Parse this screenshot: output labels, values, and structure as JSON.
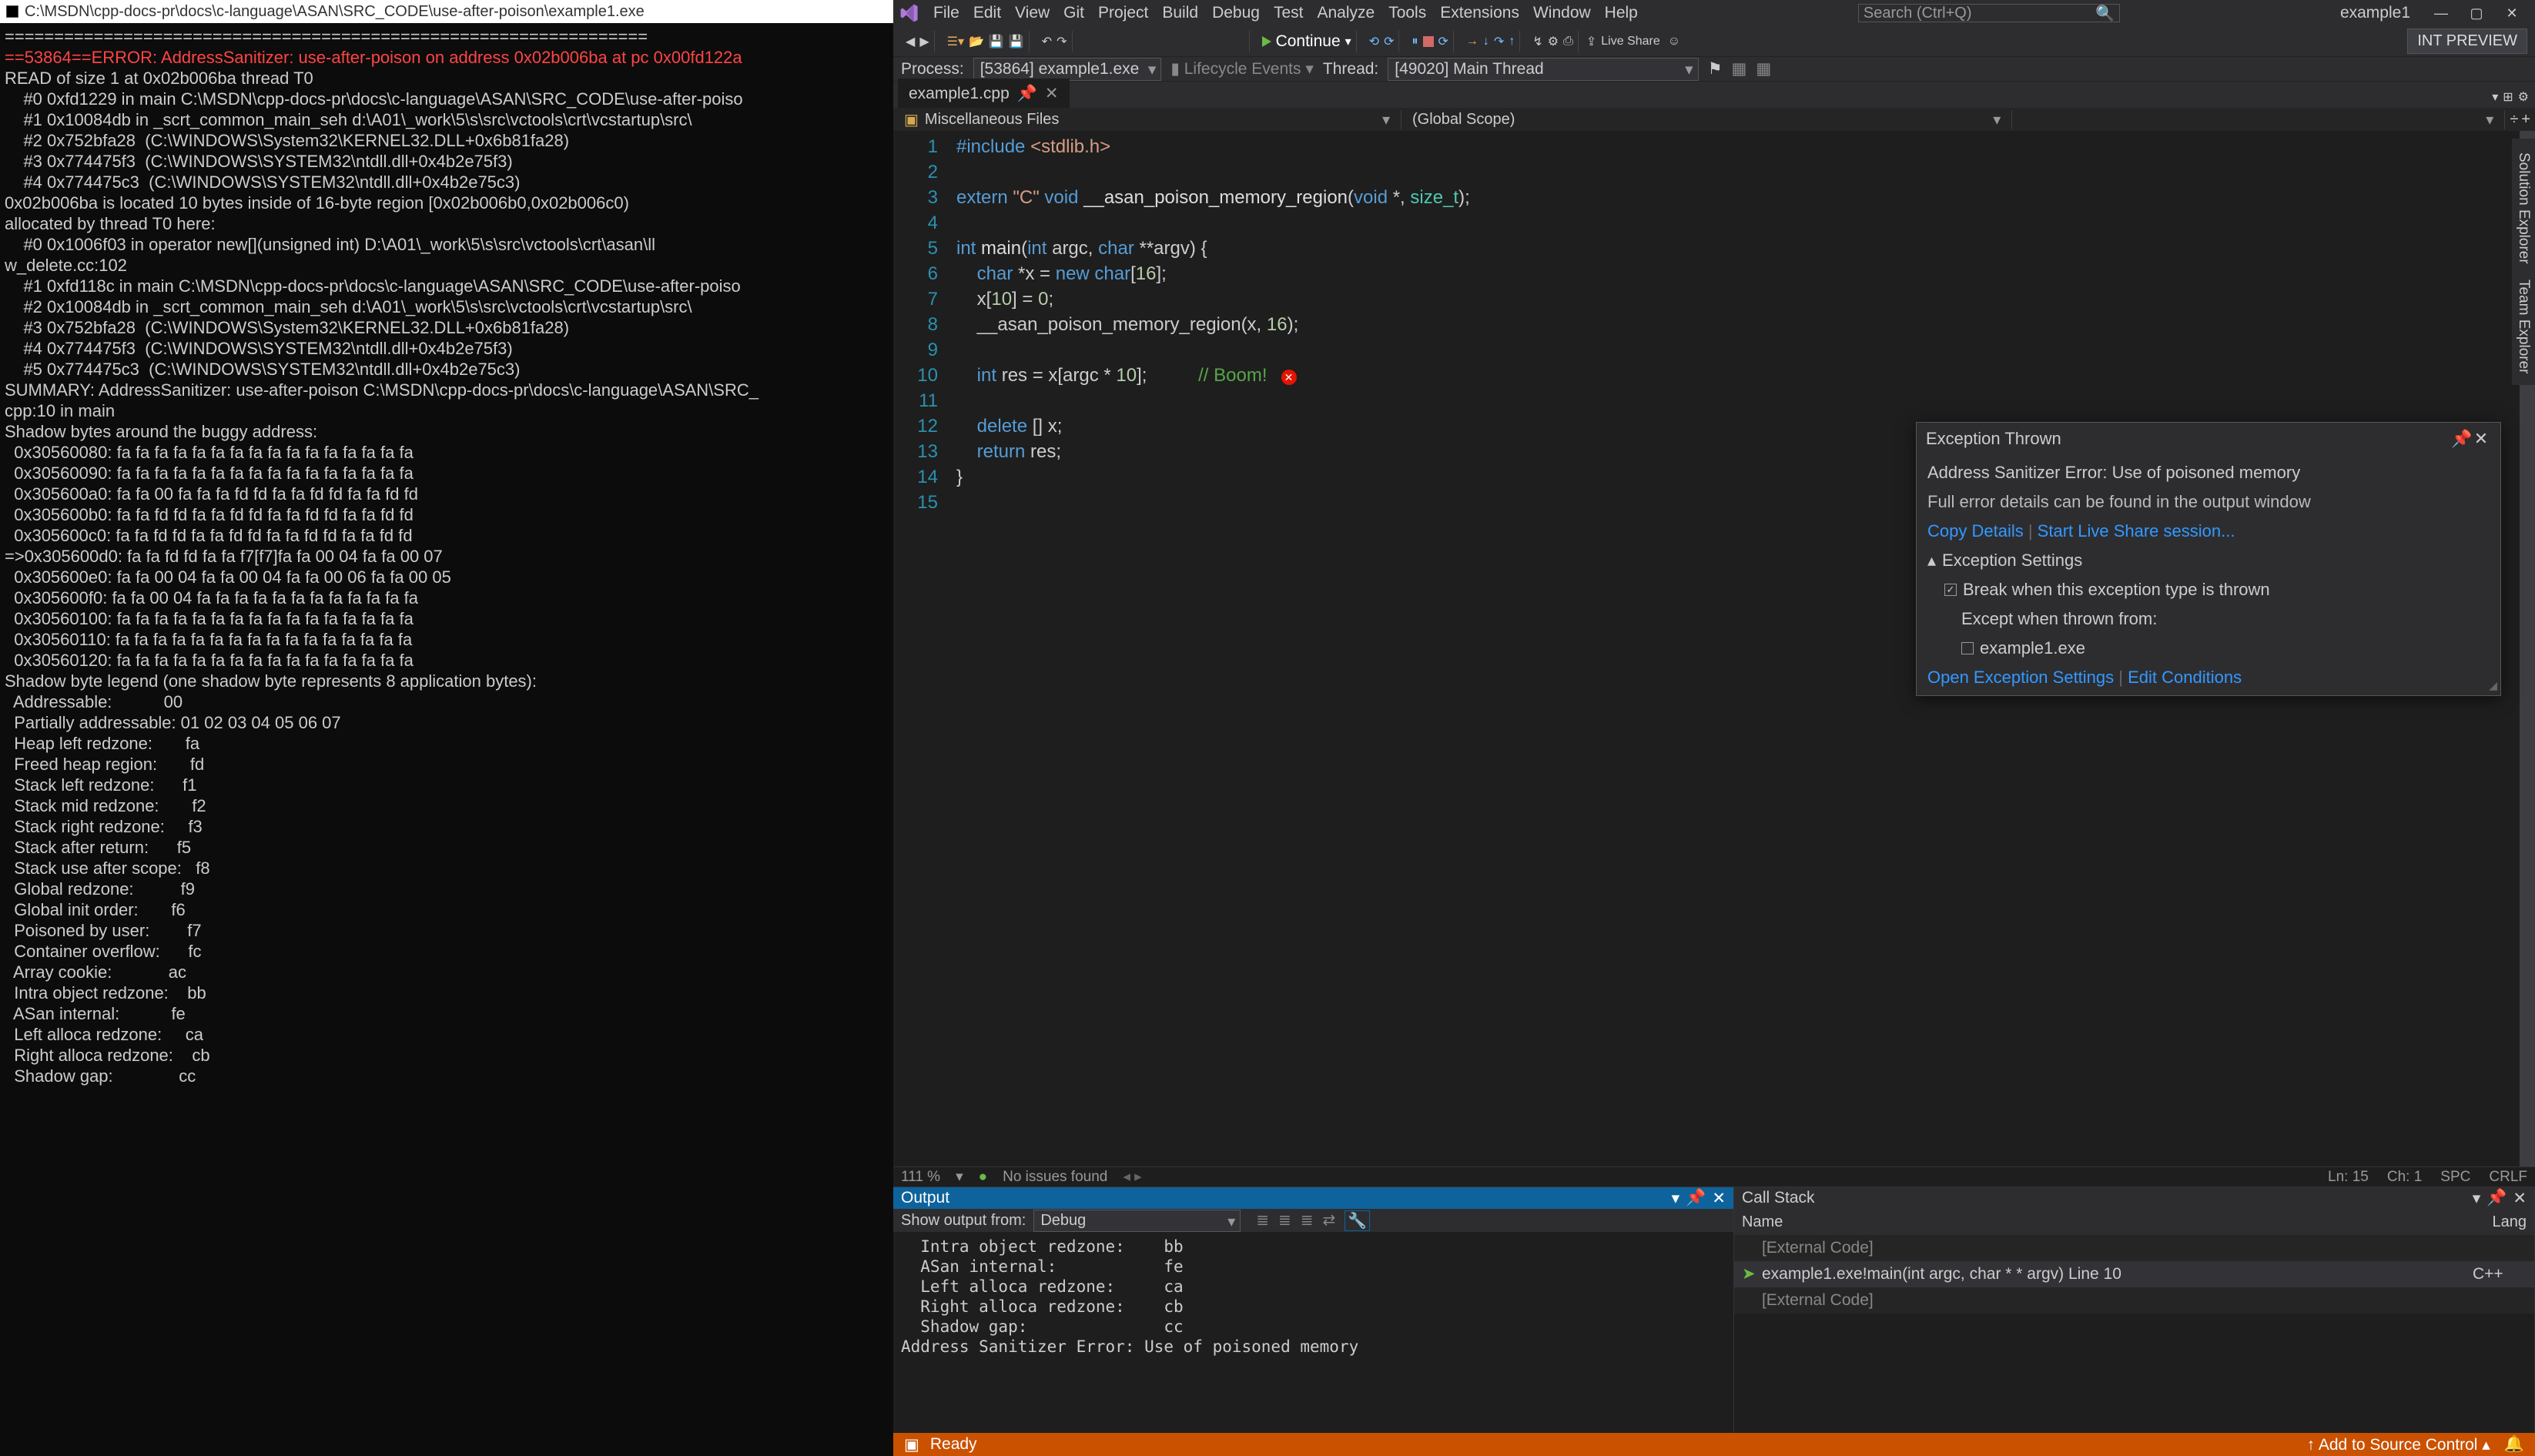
{
  "console": {
    "title": "C:\\MSDN\\cpp-docs-pr\\docs\\c-language\\ASAN\\SRC_CODE\\use-after-poison\\example1.exe",
    "lines": [
      "=================================================================",
      "==53864==ERROR: AddressSanitizer: use-after-poison on address 0x02b006ba at pc 0x00fd122a",
      "READ of size 1 at 0x02b006ba thread T0",
      "    #0 0xfd1229 in main C:\\MSDN\\cpp-docs-pr\\docs\\c-language\\ASAN\\SRC_CODE\\use-after-poiso",
      "    #1 0x10084db in _scrt_common_main_seh d:\\A01\\_work\\5\\s\\src\\vctools\\crt\\vcstartup\\src\\",
      "    #2 0x752bfa28  (C:\\WINDOWS\\System32\\KERNEL32.DLL+0x6b81fa28)",
      "    #3 0x774475f3  (C:\\WINDOWS\\SYSTEM32\\ntdll.dll+0x4b2e75f3)",
      "    #4 0x774475c3  (C:\\WINDOWS\\SYSTEM32\\ntdll.dll+0x4b2e75c3)",
      "",
      "0x02b006ba is located 10 bytes inside of 16-byte region [0x02b006b0,0x02b006c0)",
      "allocated by thread T0 here:",
      "    #0 0x1006f03 in operator new[](unsigned int) D:\\A01\\_work\\5\\s\\src\\vctools\\crt\\asan\\ll",
      "w_delete.cc:102",
      "    #1 0xfd118c in main C:\\MSDN\\cpp-docs-pr\\docs\\c-language\\ASAN\\SRC_CODE\\use-after-poiso",
      "    #2 0x10084db in _scrt_common_main_seh d:\\A01\\_work\\5\\s\\src\\vctools\\crt\\vcstartup\\src\\",
      "    #3 0x752bfa28  (C:\\WINDOWS\\System32\\KERNEL32.DLL+0x6b81fa28)",
      "    #4 0x774475f3  (C:\\WINDOWS\\SYSTEM32\\ntdll.dll+0x4b2e75f3)",
      "    #5 0x774475c3  (C:\\WINDOWS\\SYSTEM32\\ntdll.dll+0x4b2e75c3)",
      "",
      "SUMMARY: AddressSanitizer: use-after-poison C:\\MSDN\\cpp-docs-pr\\docs\\c-language\\ASAN\\SRC_",
      "cpp:10 in main",
      "Shadow bytes around the buggy address:",
      "  0x30560080: fa fa fa fa fa fa fa fa fa fa fa fa fa fa fa fa",
      "  0x30560090: fa fa fa fa fa fa fa fa fa fa fa fa fa fa fa fa",
      "  0x305600a0: fa fa 00 fa fa fa fd fd fa fa fd fd fa fa fd fd",
      "  0x305600b0: fa fa fd fd fa fa fd fd fa fa fd fd fa fa fd fd",
      "  0x305600c0: fa fa fd fd fa fa fd fd fa fa fd fd fa fa fd fd",
      "=>0x305600d0: fa fa fd fd fa fa f7[f7]fa fa 00 04 fa fa 00 07",
      "  0x305600e0: fa fa 00 04 fa fa 00 04 fa fa 00 06 fa fa 00 05",
      "  0x305600f0: fa fa 00 04 fa fa fa fa fa fa fa fa fa fa fa fa",
      "  0x30560100: fa fa fa fa fa fa fa fa fa fa fa fa fa fa fa fa",
      "  0x30560110: fa fa fa fa fa fa fa fa fa fa fa fa fa fa fa fa",
      "  0x30560120: fa fa fa fa fa fa fa fa fa fa fa fa fa fa fa fa",
      "Shadow byte legend (one shadow byte represents 8 application bytes):",
      "  Addressable:           00",
      "  Partially addressable: 01 02 03 04 05 06 07",
      "  Heap left redzone:       fa",
      "  Freed heap region:       fd",
      "  Stack left redzone:      f1",
      "  Stack mid redzone:       f2",
      "  Stack right redzone:     f3",
      "  Stack after return:      f5",
      "  Stack use after scope:   f8",
      "  Global redzone:          f9",
      "  Global init order:       f6",
      "  Poisoned by user:        f7",
      "  Container overflow:      fc",
      "  Array cookie:            ac",
      "  Intra object redzone:    bb",
      "  ASan internal:           fe",
      "  Left alloca redzone:     ca",
      "  Right alloca redzone:    cb",
      "  Shadow gap:              cc"
    ]
  },
  "menu": [
    "File",
    "Edit",
    "View",
    "Git",
    "Project",
    "Build",
    "Debug",
    "Test",
    "Analyze",
    "Tools",
    "Extensions",
    "Window",
    "Help"
  ],
  "search_placeholder": "Search (Ctrl+Q)",
  "doc_title": "example1",
  "toolbar": {
    "continue": "Continue",
    "live_share": "Live Share",
    "int_preview": "INT PREVIEW"
  },
  "process_bar": {
    "process_label": "Process:",
    "process_value": "[53864] example1.exe",
    "lifecycle": "Lifecycle Events",
    "thread_label": "Thread:",
    "thread_value": "[49020] Main Thread"
  },
  "side_tabs": [
    "Solution Explorer",
    "Team Explorer"
  ],
  "doc_tab": "example1.cpp",
  "nav_scope1": "Miscellaneous Files",
  "nav_scope2": "(Global Scope)",
  "code_lines": 15,
  "editor_status": {
    "zoom": "111 %",
    "issues": "No issues found",
    "ln": "Ln: 15",
    "ch": "Ch: 1",
    "spc": "SPC",
    "crlf": "CRLF"
  },
  "exception": {
    "title": "Exception Thrown",
    "message": "Address Sanitizer Error: Use of poisoned memory",
    "detail": "Full error details can be found in the output window",
    "copy": "Copy Details",
    "start_ls": "Start Live Share session...",
    "settings_hdr": "Exception Settings",
    "break_when": "Break when this exception type is thrown",
    "except_from": "Except when thrown from:",
    "module": "example1.exe",
    "open_settings": "Open Exception Settings",
    "edit_cond": "Edit Conditions"
  },
  "output": {
    "title": "Output",
    "show_from": "Show output from:",
    "source": "Debug",
    "lines": [
      "  Intra object redzone:    bb",
      "  ASan internal:           fe",
      "  Left alloca redzone:     ca",
      "  Right alloca redzone:    cb",
      "  Shadow gap:              cc",
      "Address Sanitizer Error: Use of poisoned memory"
    ]
  },
  "callstack": {
    "title": "Call Stack",
    "col_name": "Name",
    "col_lang": "Lang",
    "rows": [
      {
        "name": "[External Code]",
        "lang": "",
        "dim": true,
        "active": false
      },
      {
        "name": "example1.exe!main(int argc, char * * argv) Line 10",
        "lang": "C++",
        "dim": false,
        "active": true
      },
      {
        "name": "[External Code]",
        "lang": "",
        "dim": true,
        "active": false
      }
    ]
  },
  "statusbar": {
    "ready": "Ready",
    "add_src": "Add to Source Control"
  }
}
